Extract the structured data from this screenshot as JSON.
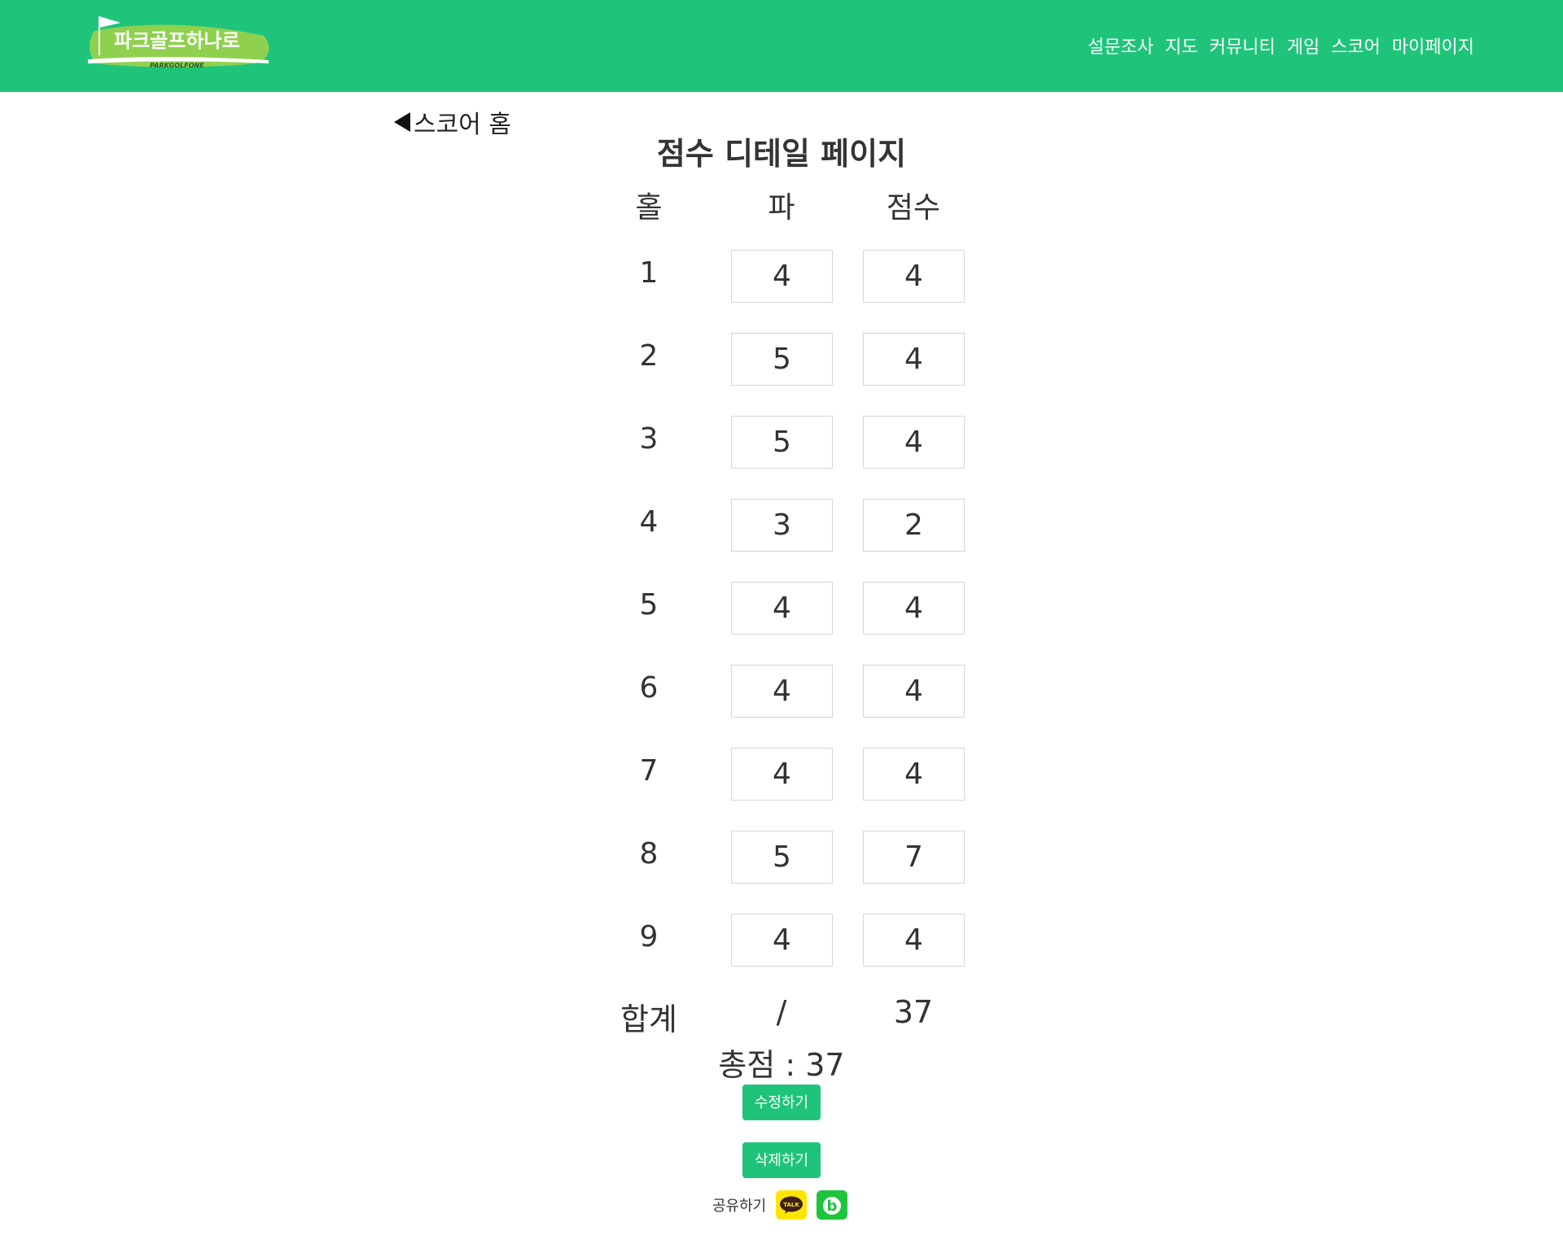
{
  "header": {
    "logo_text": "파크골프하나로",
    "logo_sub": "PARKGOLFONE",
    "nav": [
      "설문조사",
      "지도",
      "커뮤니티",
      "게임",
      "스코어",
      "마이페이지"
    ]
  },
  "back_link": "스코어 홈",
  "page_title": "점수 디테일 페이지",
  "columns": [
    "홀",
    "파",
    "점수"
  ],
  "rows": [
    {
      "hole": "1",
      "par": "4",
      "score": "4"
    },
    {
      "hole": "2",
      "par": "5",
      "score": "4"
    },
    {
      "hole": "3",
      "par": "5",
      "score": "4"
    },
    {
      "hole": "4",
      "par": "3",
      "score": "2"
    },
    {
      "hole": "5",
      "par": "4",
      "score": "4"
    },
    {
      "hole": "6",
      "par": "4",
      "score": "4"
    },
    {
      "hole": "7",
      "par": "4",
      "score": "4"
    },
    {
      "hole": "8",
      "par": "5",
      "score": "7"
    },
    {
      "hole": "9",
      "par": "4",
      "score": "4"
    }
  ],
  "total": {
    "label": "합계",
    "par": "/",
    "score": "37"
  },
  "grand_total": "총점 : 37",
  "buttons": {
    "edit": "수정하기",
    "delete": "삭제하기"
  },
  "share": {
    "label": "공유하기",
    "kakao_text": "TALK",
    "band_text": "b"
  },
  "colors": {
    "accent": "#1fc47a",
    "kakao": "#fee500",
    "band": "#1fc43d"
  }
}
